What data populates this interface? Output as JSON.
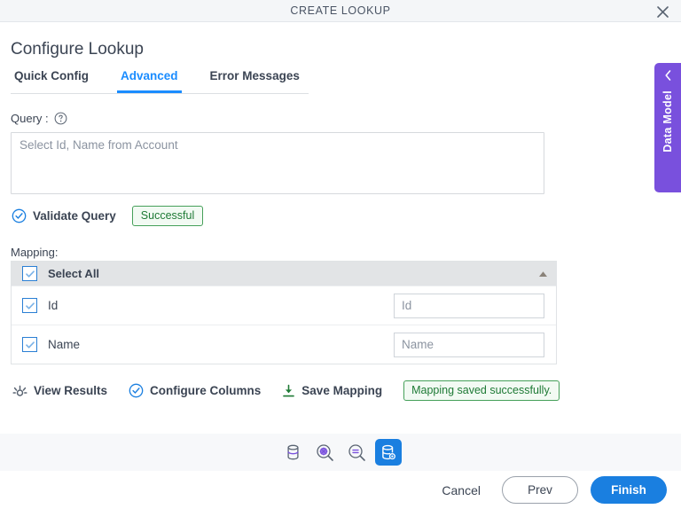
{
  "window": {
    "title": "CREATE LOOKUP",
    "close_icon": "close-icon"
  },
  "header": {
    "page_title": "Configure Lookup"
  },
  "tabs": [
    {
      "label": "Quick Config",
      "active": false
    },
    {
      "label": "Advanced",
      "active": true
    },
    {
      "label": "Error Messages",
      "active": false
    }
  ],
  "query": {
    "label": "Query :",
    "help_icon": "help-circle-icon",
    "value": "",
    "placeholder": "Select Id, Name from Account"
  },
  "validate": {
    "icon": "circle-check-icon",
    "label": "Validate Query",
    "status_badge": "Successful"
  },
  "mapping": {
    "label": "Mapping:",
    "select_all_label": "Select All",
    "select_all_checked": true,
    "collapse_icon": "triangle-up-icon",
    "rows": [
      {
        "label": "Id",
        "checked": true,
        "input_value": "",
        "input_placeholder": "Id"
      },
      {
        "label": "Name",
        "checked": true,
        "input_value": "",
        "input_placeholder": "Name"
      }
    ]
  },
  "actions": {
    "view_results": {
      "label": "View Results",
      "icon": "preview-results-icon"
    },
    "configure_columns": {
      "label": "Configure Columns",
      "icon": "circle-check-icon"
    },
    "save_mapping": {
      "label": "Save Mapping",
      "icon": "download-icon"
    },
    "saved_badge": "Mapping saved successfully."
  },
  "toolbar": [
    {
      "icon": "database-icon",
      "active": false
    },
    {
      "icon": "search-gear-icon",
      "active": false
    },
    {
      "icon": "search-minus-icon",
      "active": false
    },
    {
      "icon": "database-gear-icon",
      "active": true
    }
  ],
  "footer": {
    "cancel_label": "Cancel",
    "prev_label": "Prev",
    "finish_label": "Finish"
  },
  "side_panel": {
    "label": "Data Model",
    "chevron_icon": "chevron-left-icon"
  },
  "colors": {
    "accent_blue": "#1a7fe0",
    "tab_active_blue": "#1a8cff",
    "success_green": "#46a05a",
    "purple": "#7950dd",
    "text_dark": "#3b4453"
  }
}
